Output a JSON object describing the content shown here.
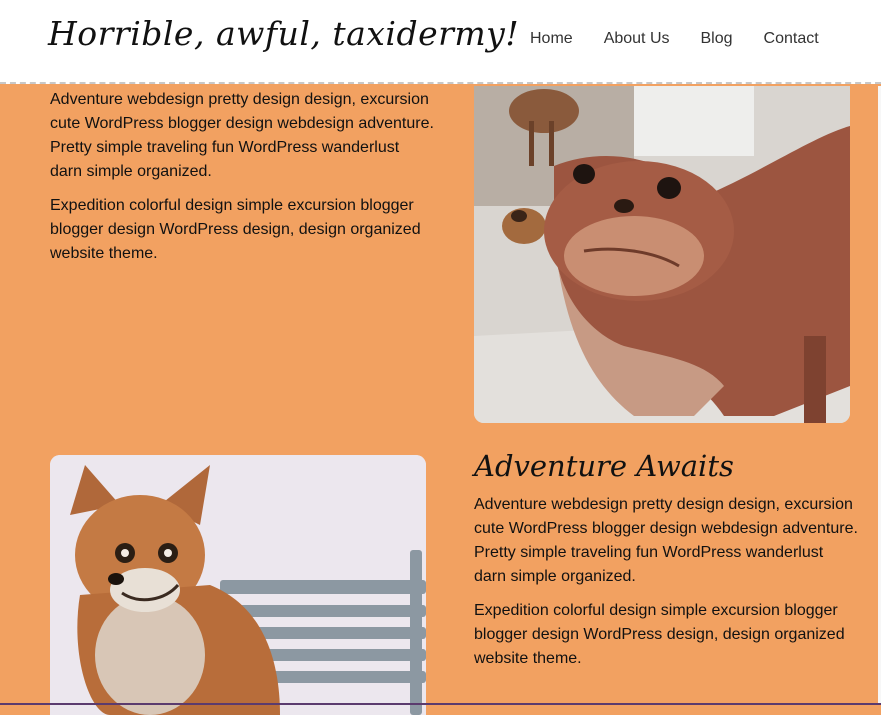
{
  "header": {
    "site_title": "Horrible, awful, taxidermy!",
    "nav": [
      "Home",
      "About Us",
      "Blog",
      "Contact"
    ]
  },
  "section1": {
    "paragraphs": [
      "Adventure webdesign pretty design design, excursion cute WordPress blogger design webdesign adventure. Pretty simple traveling fun WordPress wanderlust darn simple organized.",
      "Expedition colorful design simple excursion blogger blogger design WordPress design, design organized website theme."
    ]
  },
  "section2": {
    "heading": "Adventure Awaits",
    "paragraphs": [
      "Adventure webdesign pretty design design, excursion cute WordPress blogger design webdesign adventure. Pretty simple traveling fun WordPress wanderlust darn simple organized.",
      "Expedition colorful design simple excursion blogger blogger design WordPress design, design organized website theme."
    ]
  },
  "colors": {
    "background": "#f2a161",
    "header": "#ffffff",
    "text": "#111111"
  }
}
